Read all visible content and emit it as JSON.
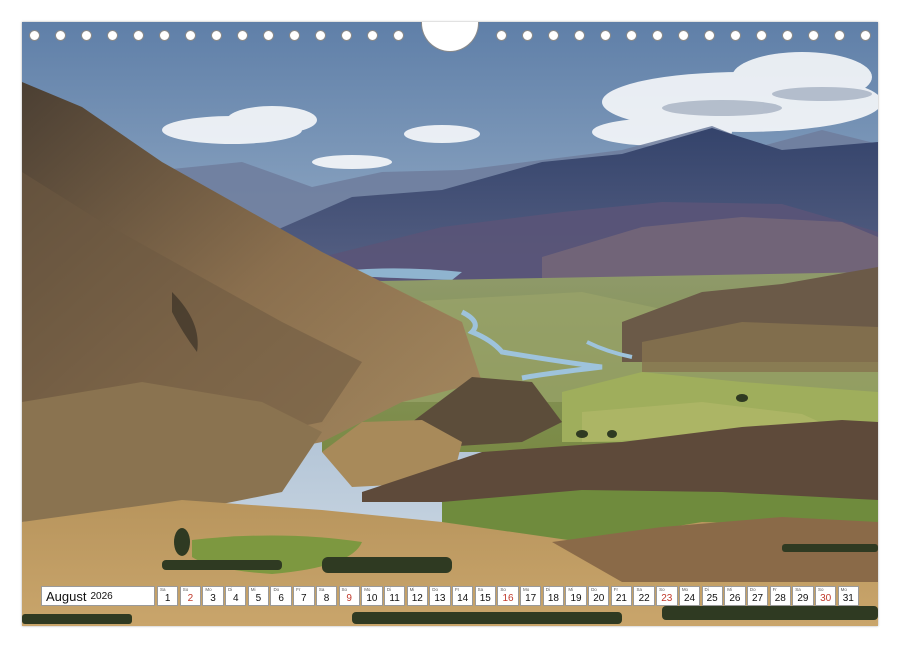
{
  "calendar": {
    "month": "August",
    "year": "2026",
    "days": [
      {
        "abbr": "Sa",
        "num": "1",
        "sunday": false
      },
      {
        "abbr": "So",
        "num": "2",
        "sunday": true
      },
      {
        "abbr": "Mo",
        "num": "3",
        "sunday": false
      },
      {
        "abbr": "Di",
        "num": "4",
        "sunday": false
      },
      {
        "abbr": "Mi",
        "num": "5",
        "sunday": false
      },
      {
        "abbr": "Do",
        "num": "6",
        "sunday": false
      },
      {
        "abbr": "Fr",
        "num": "7",
        "sunday": false
      },
      {
        "abbr": "Sa",
        "num": "8",
        "sunday": false
      },
      {
        "abbr": "So",
        "num": "9",
        "sunday": true
      },
      {
        "abbr": "Mo",
        "num": "10",
        "sunday": false
      },
      {
        "abbr": "Di",
        "num": "11",
        "sunday": false
      },
      {
        "abbr": "Mi",
        "num": "12",
        "sunday": false
      },
      {
        "abbr": "Do",
        "num": "13",
        "sunday": false
      },
      {
        "abbr": "Fr",
        "num": "14",
        "sunday": false
      },
      {
        "abbr": "Sa",
        "num": "15",
        "sunday": false
      },
      {
        "abbr": "So",
        "num": "16",
        "sunday": true
      },
      {
        "abbr": "Mo",
        "num": "17",
        "sunday": false
      },
      {
        "abbr": "Di",
        "num": "18",
        "sunday": false
      },
      {
        "abbr": "Mi",
        "num": "19",
        "sunday": false
      },
      {
        "abbr": "Do",
        "num": "20",
        "sunday": false
      },
      {
        "abbr": "Fr",
        "num": "21",
        "sunday": false
      },
      {
        "abbr": "Sa",
        "num": "22",
        "sunday": false
      },
      {
        "abbr": "So",
        "num": "23",
        "sunday": true
      },
      {
        "abbr": "Mo",
        "num": "24",
        "sunday": false
      },
      {
        "abbr": "Di",
        "num": "25",
        "sunday": false
      },
      {
        "abbr": "Mi",
        "num": "26",
        "sunday": false
      },
      {
        "abbr": "Do",
        "num": "27",
        "sunday": false
      },
      {
        "abbr": "Fr",
        "num": "28",
        "sunday": false
      },
      {
        "abbr": "Sa",
        "num": "29",
        "sunday": false
      },
      {
        "abbr": "So",
        "num": "30",
        "sunday": true
      },
      {
        "abbr": "Mo",
        "num": "31",
        "sunday": false
      }
    ]
  },
  "colors": {
    "sunday": "#c0392b",
    "sky_top": "#6d8db3",
    "sky_bottom": "#c9d6e2",
    "mountain_far": "#3e4f78",
    "hillside": "#8c7452",
    "grass": "#7f9a45",
    "river": "#8fb4cf"
  },
  "binding": {
    "left_holes": 15,
    "right_holes": 15
  },
  "photo": {
    "subject": "mountain-valley-landscape"
  }
}
